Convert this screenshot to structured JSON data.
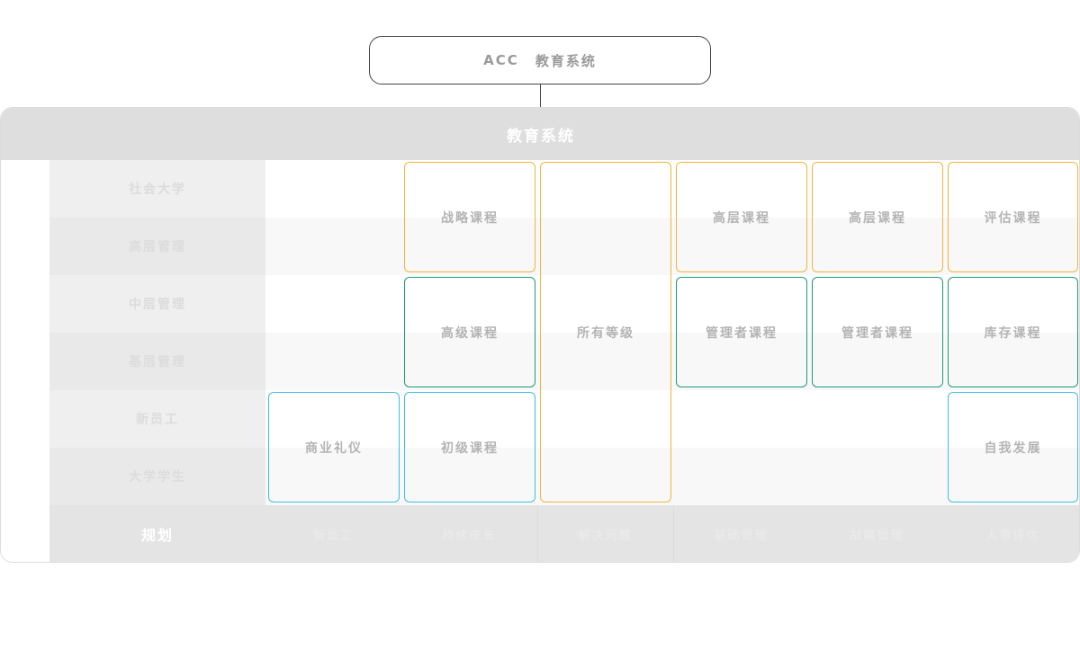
{
  "root": {
    "label": "ACC",
    "title": "教育系统"
  },
  "panel": {
    "title": "教育系统"
  },
  "row_labels": [
    "社会大学",
    "高层管理",
    "中层管理",
    "基层管理",
    "新员工",
    "大学学生"
  ],
  "footer": [
    "规划",
    "新员工",
    "持续成长",
    "解决问题",
    "基础管理",
    "战略管理",
    "人事评估"
  ],
  "cards": {
    "strategy": "战略课程",
    "all_levels": "所有等级",
    "senior_1": "高层课程",
    "senior_2": "高层课程",
    "evaluation": "评估课程",
    "advanced": "高级课程",
    "manager_1": "管理者课程",
    "manager_2": "管理者课程",
    "inventory": "库存课程",
    "etiquette": "商业礼仪",
    "beginner": "初级课程",
    "self_dev": "自我发展"
  },
  "colors": {
    "orange": "#f0b43c",
    "green": "#1e9a7a",
    "cyan": "#3cc0de",
    "header": "#dedede"
  }
}
